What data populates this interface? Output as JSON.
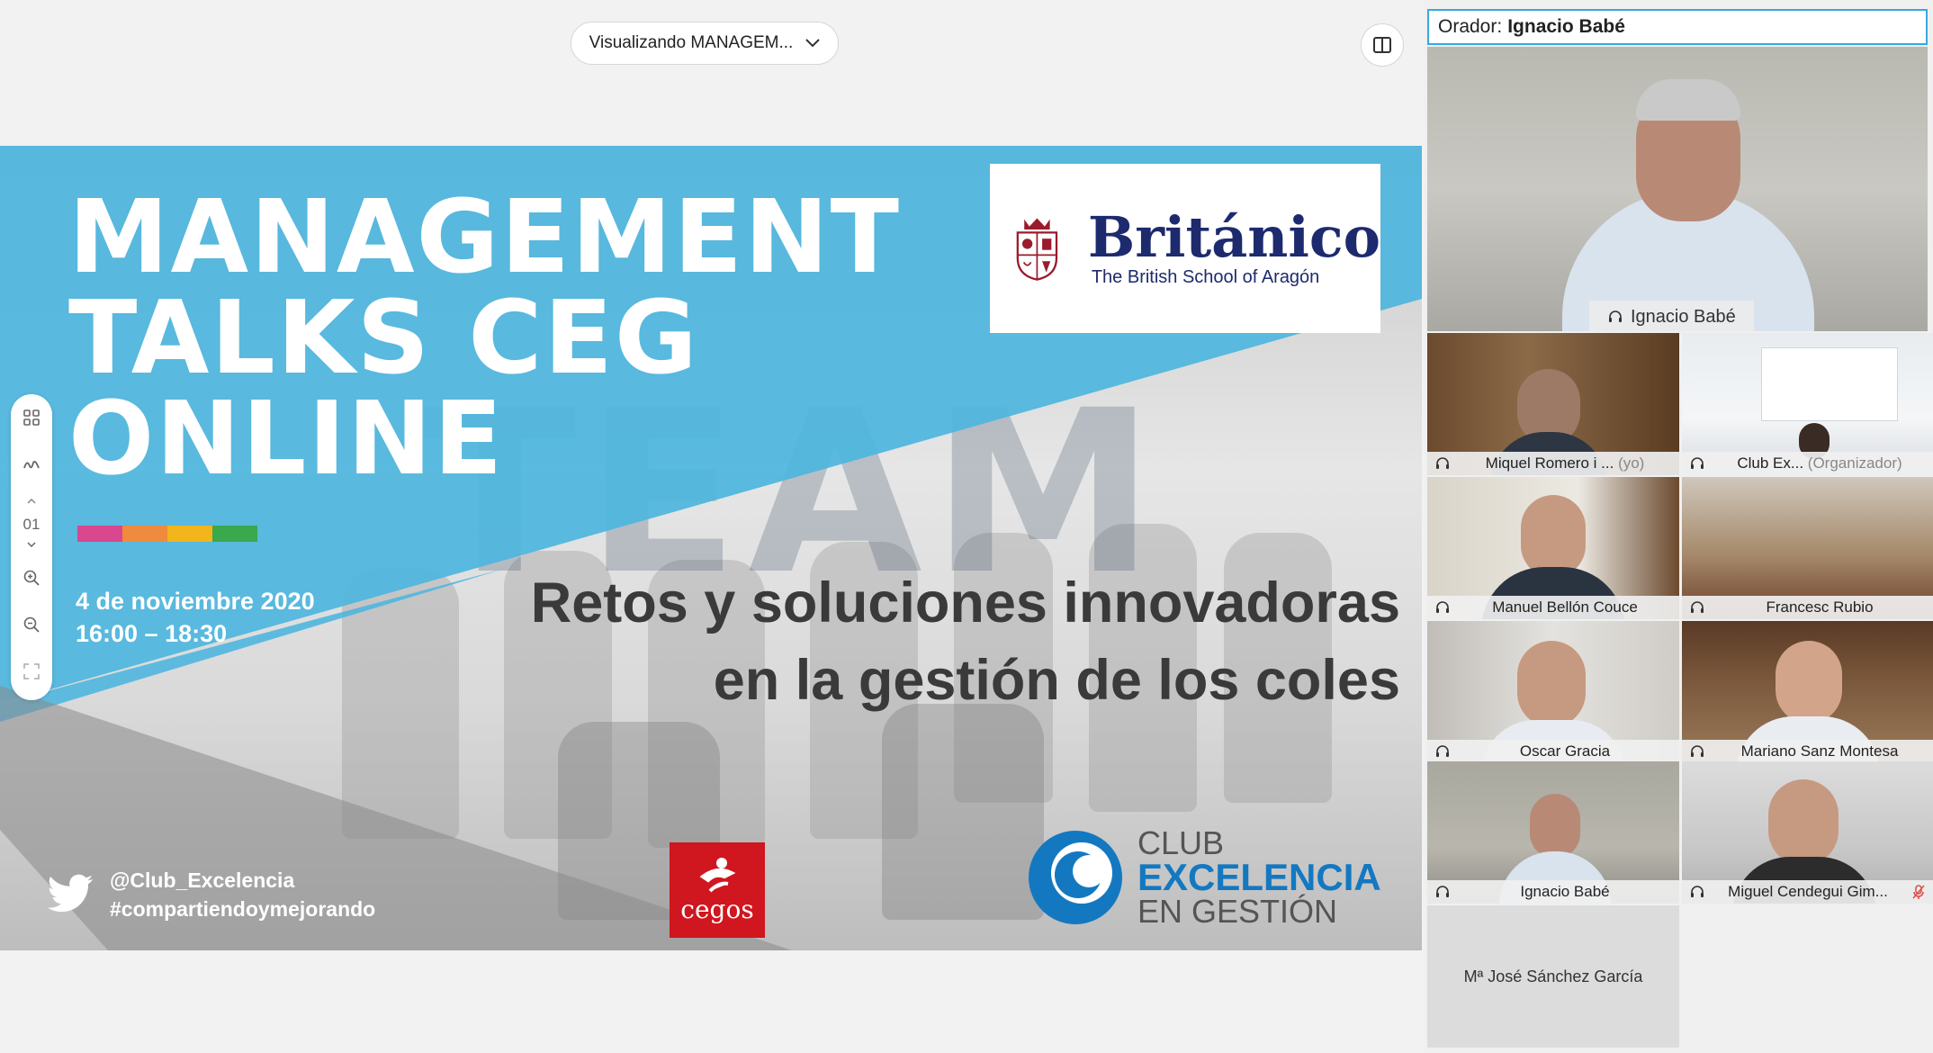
{
  "viewer": {
    "view_select_label": "Visualizando MANAGEM...",
    "panel_toggle_icon": "side-panel-icon"
  },
  "slide": {
    "title_lines": [
      "MANAGEMENT",
      "TALKS CEG",
      "ONLINE"
    ],
    "background_word": "TEAM",
    "color_bar": [
      "#d9478f",
      "#f08a3c",
      "#f2b51c",
      "#3aa84c"
    ],
    "date": "4 de noviembre 2020",
    "time": "16:00 – 18:30",
    "subtitle_line1": "Retos y soluciones innovadoras",
    "subtitle_line2": "en la gestión de los coles",
    "britanico_name": "Británico",
    "britanico_sub": "The British School of Aragón",
    "twitter_handle": "@Club_Excelencia",
    "twitter_hashtag": "#compartiendoymejorando",
    "cegos_label": "cegos",
    "club_line1": "CLUB",
    "club_line2": "EXCELENCIA",
    "club_line3": "EN GESTIÓN",
    "blue_color": "#4fb6de"
  },
  "toolbar": {
    "page_number": "01",
    "icons": [
      "thumbnails-icon",
      "annotate-icon",
      "chevron-up-icon",
      "chevron-down-icon",
      "zoom-in-icon",
      "zoom-out-icon",
      "fit-screen-icon"
    ]
  },
  "participants": {
    "speaker_prefix": "Orador:",
    "speaker_name": "Ignacio Babé",
    "main_tag": "Ignacio Babé",
    "tiles": [
      {
        "name": "Miquel Romero i ...",
        "extra": "(yo)"
      },
      {
        "name": "Club Ex...",
        "extra": "(Organizador)"
      },
      {
        "name": "Manuel Bellón Couce",
        "extra": ""
      },
      {
        "name": "Francesc Rubio",
        "extra": ""
      },
      {
        "name": "Oscar Gracia",
        "extra": ""
      },
      {
        "name": "Mariano Sanz Montesa",
        "extra": ""
      },
      {
        "name": "Ignacio Babé",
        "extra": ""
      },
      {
        "name": "Miguel Cendegui Gim...",
        "extra": ""
      }
    ],
    "audio_only": "Mª José Sánchez García",
    "accent": "#36a9e1",
    "muted_color": "#d9534f"
  }
}
